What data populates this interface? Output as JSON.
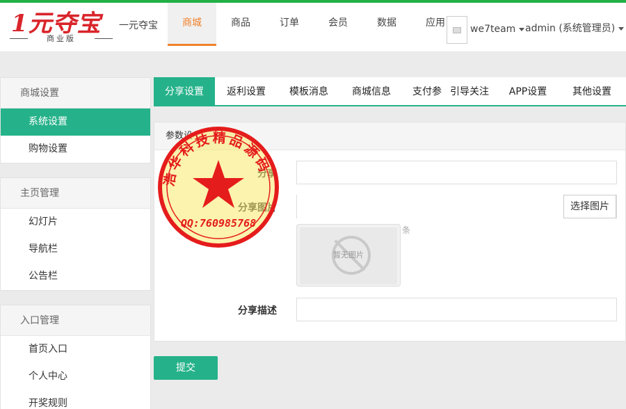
{
  "header": {
    "logo_text": "1元夺宝",
    "logo_sub": "商业版",
    "brand_name": "一元夺宝",
    "nav": [
      "商城",
      "商品",
      "订单",
      "会员",
      "数据",
      "应用"
    ],
    "active_nav": 0,
    "user_name": "we7team",
    "admin_label": "admin (系统管理员)"
  },
  "sidebar": [
    {
      "title": "商城设置",
      "items": [
        "系统设置",
        "购物设置"
      ],
      "active_item": 0
    },
    {
      "title": "主页管理",
      "items": [
        "幻灯片",
        "导航栏",
        "公告栏"
      ]
    },
    {
      "title": "入口管理",
      "items": [
        "首页入口",
        "个人中心",
        "开奖规则"
      ]
    }
  ],
  "tabs": [
    "分享设置",
    "返利设置",
    "模板消息",
    "商城信息",
    "支付参",
    "引导关注",
    "APP设置",
    "其他设置"
  ],
  "active_tab": 0,
  "panel": {
    "title": "参数设",
    "fields": {
      "share_title_label": "分享",
      "share_image_label": "分享图片",
      "share_desc_label": "分享描述",
      "share_title_value": "",
      "share_image_value": "",
      "share_desc_value": "",
      "pick_image_button": "选择图片",
      "no_image_text": "暂无图片",
      "remove_text": "条"
    }
  },
  "submit_label": "提交",
  "seal": {
    "ring_text": "浩华科技精品源码",
    "contact": "QQ:760985768"
  },
  "colors": {
    "accent": "#25b28a",
    "nav_active": "#f0812c",
    "top_line": "#22b046",
    "logo_red": "#d9252b"
  }
}
